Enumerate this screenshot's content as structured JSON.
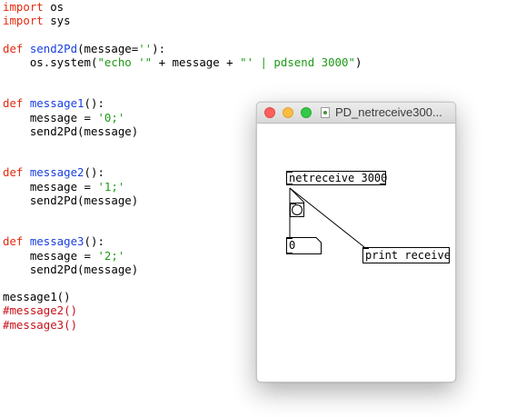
{
  "editor": {
    "lines": [
      {
        "parts": [
          {
            "text": "import",
            "cls": "kw"
          },
          {
            "text": " os",
            "cls": ""
          }
        ]
      },
      {
        "parts": [
          {
            "text": "import",
            "cls": "kw"
          },
          {
            "text": " sys",
            "cls": ""
          }
        ]
      },
      {
        "parts": []
      },
      {
        "parts": [
          {
            "text": "def ",
            "cls": "kw"
          },
          {
            "text": "send2Pd",
            "cls": "fn"
          },
          {
            "text": "(message=",
            "cls": ""
          },
          {
            "text": "''",
            "cls": "str"
          },
          {
            "text": "):",
            "cls": ""
          }
        ]
      },
      {
        "parts": [
          {
            "text": "    os.system(",
            "cls": ""
          },
          {
            "text": "\"echo '\"",
            "cls": "str"
          },
          {
            "text": " + message + ",
            "cls": ""
          },
          {
            "text": "\"' | pdsend 3000\"",
            "cls": "str"
          },
          {
            "text": ")",
            "cls": ""
          }
        ]
      },
      {
        "parts": []
      },
      {
        "parts": []
      },
      {
        "parts": [
          {
            "text": "def ",
            "cls": "kw"
          },
          {
            "text": "message1",
            "cls": "fn"
          },
          {
            "text": "():",
            "cls": ""
          }
        ]
      },
      {
        "parts": [
          {
            "text": "    message = ",
            "cls": ""
          },
          {
            "text": "'0;'",
            "cls": "str"
          }
        ]
      },
      {
        "parts": [
          {
            "text": "    send2Pd(message)",
            "cls": ""
          }
        ]
      },
      {
        "parts": []
      },
      {
        "parts": []
      },
      {
        "parts": [
          {
            "text": "def ",
            "cls": "kw"
          },
          {
            "text": "message2",
            "cls": "fn"
          },
          {
            "text": "():",
            "cls": ""
          }
        ]
      },
      {
        "parts": [
          {
            "text": "    message = ",
            "cls": ""
          },
          {
            "text": "'1;'",
            "cls": "str"
          }
        ]
      },
      {
        "parts": [
          {
            "text": "    send2Pd(message)",
            "cls": ""
          }
        ]
      },
      {
        "parts": []
      },
      {
        "parts": []
      },
      {
        "parts": [
          {
            "text": "def ",
            "cls": "kw"
          },
          {
            "text": "message3",
            "cls": "fn"
          },
          {
            "text": "():",
            "cls": ""
          }
        ]
      },
      {
        "parts": [
          {
            "text": "    message = ",
            "cls": ""
          },
          {
            "text": "'2;'",
            "cls": "str"
          }
        ]
      },
      {
        "parts": [
          {
            "text": "    send2Pd(message)",
            "cls": ""
          }
        ]
      },
      {
        "parts": []
      },
      {
        "parts": [
          {
            "text": "message1()",
            "cls": ""
          }
        ]
      },
      {
        "parts": [
          {
            "text": "#message2()",
            "cls": "cm"
          }
        ]
      },
      {
        "parts": [
          {
            "text": "#message3()",
            "cls": "cm"
          }
        ]
      }
    ]
  },
  "pd_window": {
    "title": "PD_netreceive300...",
    "objects": {
      "netreceive": "netreceive 3000",
      "number_value": "0",
      "print": "print receive"
    }
  },
  "colors": {
    "keyword": "#e6290f",
    "function_name": "#1a3fe0",
    "string": "#1d9a16",
    "comment": "#c8101a"
  }
}
